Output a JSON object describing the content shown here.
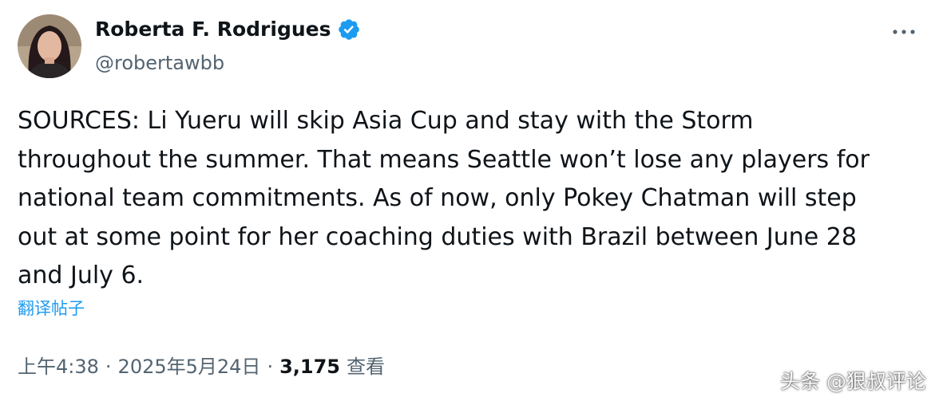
{
  "author": {
    "display_name": "Roberta F. Rodrigues",
    "handle": "@robertawbb",
    "verified": true,
    "avatar_icon": "user-avatar-photo"
  },
  "post": {
    "text": "SOURCES: Li Yueru will skip Asia Cup and stay with the Storm\nthroughout the summer. That means Seattle won’t lose any players for\nnational team commitments. As of now, only Pokey Chatman will step\nout at some point for her coaching duties with Brazil between June 28\nand July 6.",
    "translate_label": "翻译帖子",
    "time": "上午4:38",
    "separator": "·",
    "date": "2025年5月24日",
    "views_count": "3,175",
    "views_label": "查看"
  },
  "watermark": "头条 @狠叔评论",
  "colors": {
    "text": "#0f1419",
    "secondary": "#536471",
    "accent": "#1d9bf0",
    "verified_badge": "#1d9bf0"
  },
  "icons": {
    "verified": "verified-badge-icon",
    "more": "more-options-icon"
  }
}
